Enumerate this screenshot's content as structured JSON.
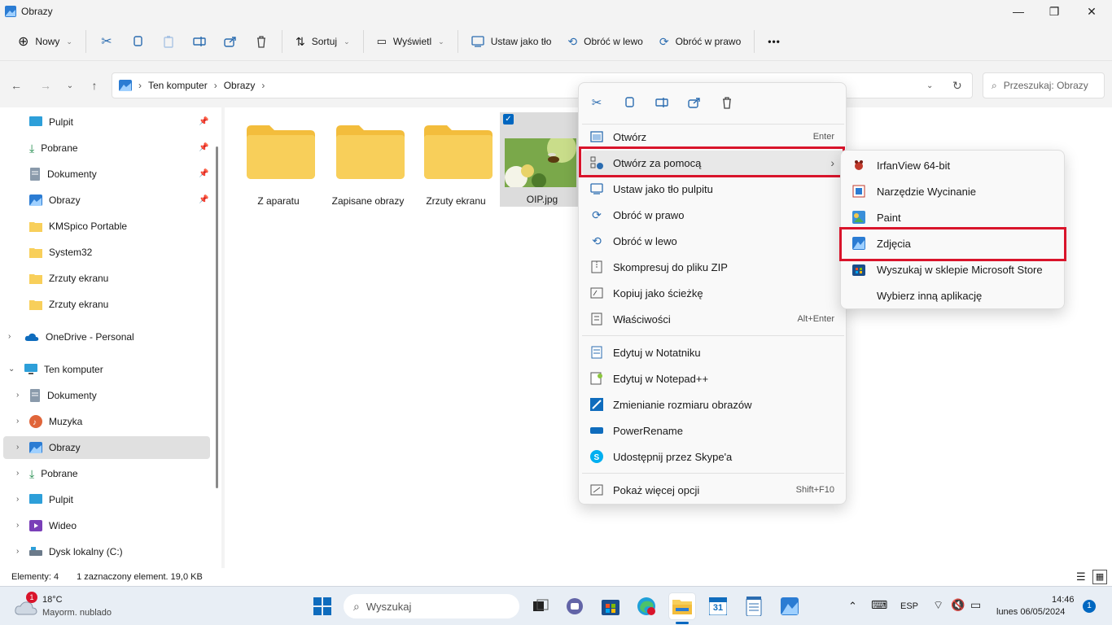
{
  "window": {
    "title": "Obrazy"
  },
  "toolbar": {
    "new_label": "Nowy",
    "sort_label": "Sortuj",
    "view_label": "Wyświetl",
    "set_bg_label": "Ustaw jako tło",
    "rotate_left_label": "Obróć w lewo",
    "rotate_right_label": "Obróć w prawo",
    "more_label": "•••"
  },
  "address": {
    "crumbs": [
      "Ten komputer",
      "Obrazy"
    ],
    "search_placeholder": "Przeszukaj: Obrazy"
  },
  "sidebar": {
    "quick": [
      {
        "label": "Pulpit"
      },
      {
        "label": "Pobrane"
      },
      {
        "label": "Dokumenty"
      },
      {
        "label": "Obrazy"
      },
      {
        "label": "KMSpico Portable"
      },
      {
        "label": "System32"
      },
      {
        "label": "Zrzuty ekranu"
      },
      {
        "label": "Zrzuty ekranu"
      }
    ],
    "onedrive": "OneDrive - Personal",
    "this_pc": "Ten komputer",
    "pc_items": [
      {
        "label": "Dokumenty"
      },
      {
        "label": "Muzyka"
      },
      {
        "label": "Obrazy"
      },
      {
        "label": "Pobrane"
      },
      {
        "label": "Pulpit"
      },
      {
        "label": "Wideo"
      },
      {
        "label": "Dysk lokalny (C:)"
      }
    ]
  },
  "content": {
    "folders": [
      {
        "label": "Z aparatu"
      },
      {
        "label": "Zapisane obrazy"
      },
      {
        "label": "Zrzuty ekranu"
      }
    ],
    "file": {
      "label": "OIP.jpg"
    }
  },
  "status": {
    "count": "Elementy: 4",
    "selection": "1 zaznaczony element. 19,0 KB"
  },
  "context_menu": {
    "items": [
      {
        "label": "Otwórz",
        "shortcut": "Enter"
      },
      {
        "label": "Otwórz za pomocą",
        "shortcut": "›"
      },
      {
        "label": "Ustaw jako tło pulpitu",
        "shortcut": ""
      },
      {
        "label": "Obróć w prawo",
        "shortcut": ""
      },
      {
        "label": "Obróć w lewo",
        "shortcut": ""
      },
      {
        "label": "Skompresuj do pliku ZIP",
        "shortcut": ""
      },
      {
        "label": "Kopiuj jako ścieżkę",
        "shortcut": ""
      },
      {
        "label": "Właściwości",
        "shortcut": "Alt+Enter"
      },
      {
        "label": "Edytuj w Notatniku",
        "shortcut": ""
      },
      {
        "label": "Edytuj w Notepad++",
        "shortcut": ""
      },
      {
        "label": "Zmienianie rozmiaru obrazów",
        "shortcut": ""
      },
      {
        "label": "PowerRename",
        "shortcut": ""
      },
      {
        "label": "Udostępnij przez Skype'a",
        "shortcut": ""
      },
      {
        "label": "Pokaż więcej opcji",
        "shortcut": "Shift+F10"
      }
    ]
  },
  "submenu": {
    "items": [
      {
        "label": "IrfanView 64-bit"
      },
      {
        "label": "Narzędzie Wycinanie"
      },
      {
        "label": "Paint"
      },
      {
        "label": "Zdjęcia"
      },
      {
        "label": "Wyszukaj w sklepie Microsoft Store"
      },
      {
        "label": "Wybierz inną aplikację"
      }
    ]
  },
  "taskbar": {
    "weather_temp": "18°C",
    "weather_desc": "Mayorm. nublado",
    "weather_badge": "1",
    "search_placeholder": "Wyszukaj",
    "lang": "ESP",
    "time": "14:46",
    "date": "lunes 06/05/2024",
    "notif_count": "1",
    "calendar_day": "31"
  },
  "colors": {
    "highlight_red": "#d9142b",
    "folder_yellow": "#f8cf5a",
    "accent_blue": "#0067c0"
  }
}
